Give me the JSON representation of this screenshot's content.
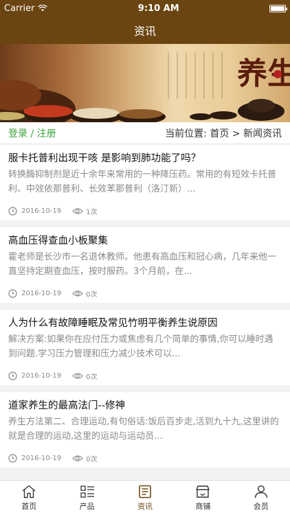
{
  "status": {
    "carrier": "Carrier",
    "time": "9:10 AM"
  },
  "nav": {
    "title": "资讯"
  },
  "banner": {
    "calligraphy": "养生"
  },
  "location": {
    "login": "登录 / 注册",
    "breadcrumb": "当前位置: 首页 > 新闻资讯"
  },
  "articles": [
    {
      "title": "服卡托普利出现干咳 是影响到肺功能了吗？",
      "desc": "转换酶抑制剂是近十余年来常用的一种降压药。常用的有短效卡托普利、中效依那普利、长效苯那普利（洛汀新）...",
      "date": "2016-10-19",
      "views": "1次"
    },
    {
      "title": "高血压得查血小板聚集",
      "desc": "霍老师是长沙市一名退休教师。他患有高血压和冠心病，几年来他一直坚持定期查血压，按时服药。3个月前，在...",
      "date": "2016-10-19",
      "views": "0次"
    },
    {
      "title": "人为什么有故障睡眠及常见竹明平衡养生说原因",
      "desc": "解决方案:如果你在应付压力或焦虑有几个简单的事情,你可以睡时遇到问题.学习压力管理和压力减少技术可以...",
      "date": "2016-10-19",
      "views": "0次"
    },
    {
      "title": "道家养生的最高法门--修神",
      "desc": "养生方法第二、合理运动,有句俗话:饭后百步走,活到九十九,这里讲的就是合理的运动,这里的运动与运动员...",
      "date": "2016-10-19",
      "views": "0次"
    }
  ],
  "tabs": [
    {
      "label": "首页",
      "icon": "home-icon"
    },
    {
      "label": "产品",
      "icon": "list-icon"
    },
    {
      "label": "资讯",
      "icon": "news-icon",
      "active": true
    },
    {
      "label": "商铺",
      "icon": "store-icon"
    },
    {
      "label": "会员",
      "icon": "user-icon"
    }
  ],
  "colors": {
    "brand": "#6b4511",
    "login": "#3aa33b"
  }
}
